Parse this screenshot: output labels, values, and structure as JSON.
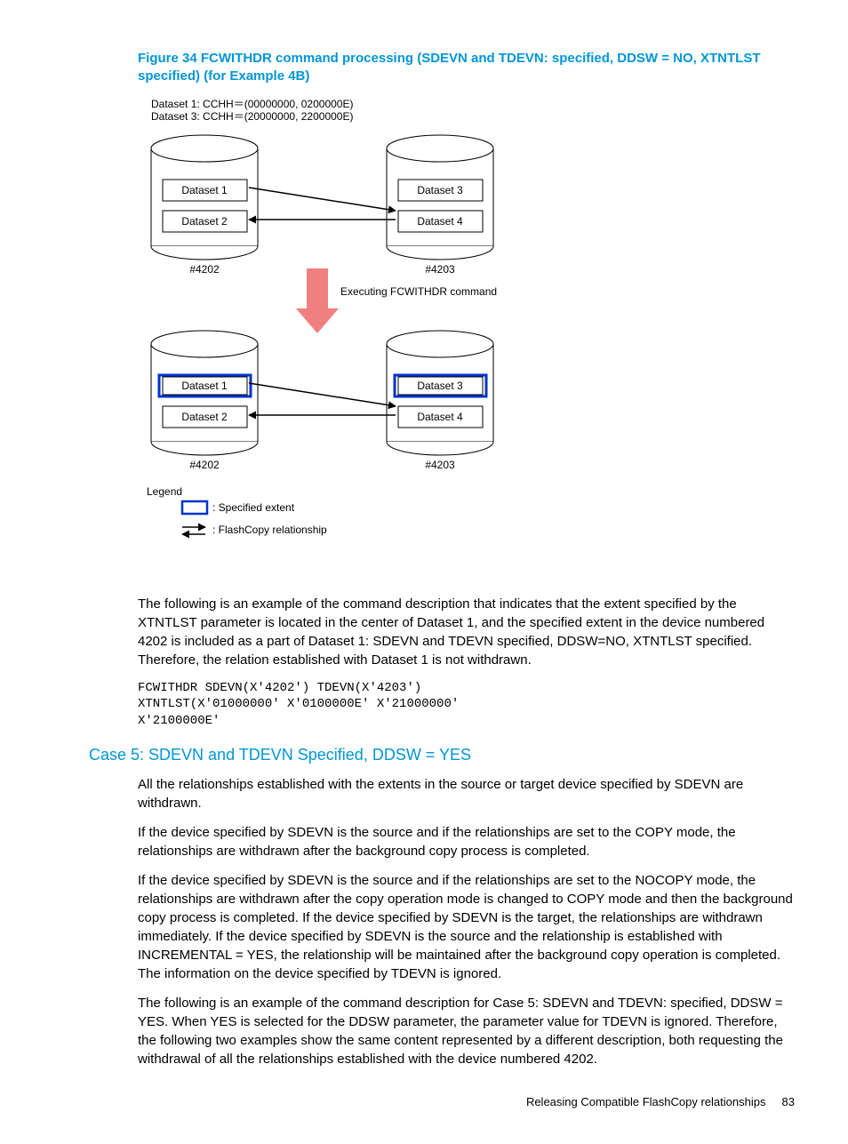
{
  "figure_title": "Figure 34 FCWITHDR command processing (SDEVN and TDEVN: specified, DDSW = NO, XTNTLST specified) (for Example 4B)",
  "diagram": {
    "header_l1": "Dataset 1:   CCHH＝(00000000, 0200000E)",
    "header_l2": "Dataset 3:   CCHH＝(20000000, 2200000E)",
    "dataset1": "Dataset 1",
    "dataset2": "Dataset 2",
    "dataset3": "Dataset 3",
    "dataset4": "Dataset 4",
    "dev4202": "#4202",
    "dev4203": "#4203",
    "executing": "Executing FCWITHDR command",
    "legend": "Legend",
    "legend_ext": ": Specified extent",
    "legend_rel": ": FlashCopy relationship"
  },
  "para1": "The following is an example of the command description that indicates that the extent specified by the XTNTLST parameter is located in the center of Dataset 1, and the specified extent in the device numbered 4202 is included as a part of Dataset 1: SDEVN and TDEVN specified, DDSW=NO, XTNTLST specified. Therefore, the relation established with Dataset 1 is not withdrawn.",
  "code": "FCWITHDR SDEVN(X'4202') TDEVN(X'4203')\nXTNTLST(X'01000000' X'0100000E' X'21000000'\nX'2100000E'",
  "section_title": "Case 5: SDEVN and TDEVN Specified, DDSW = YES",
  "para2": "All the relationships established with the extents in the source or target device specified by SDEVN are withdrawn.",
  "para3": "If the device specified by SDEVN is the source and if the relationships are set to the COPY mode, the relationships are withdrawn after the background copy process is completed.",
  "para4": "If the device specified by SDEVN is the source and if the relationships are set to the NOCOPY mode, the relationships are withdrawn after the copy operation mode is changed to COPY mode and then the background copy process is completed. If the device specified by SDEVN is the target, the relationships are withdrawn immediately. If the device specified by SDEVN is the source and the relationship is established with INCREMENTAL = YES, the relationship will be maintained after the background copy operation is completed. The information on the device specified by TDEVN is ignored.",
  "para5": "The following is an example of the command description for Case 5: SDEVN and TDEVN: specified, DDSW = YES. When YES is selected for the DDSW parameter, the parameter value for TDEVN is ignored. Therefore, the following two examples show the same content represented by a different description, both requesting the withdrawal of all the relationships established with the device numbered 4202.",
  "footer_text": "Releasing Compatible FlashCopy relationships",
  "page_number": "83"
}
